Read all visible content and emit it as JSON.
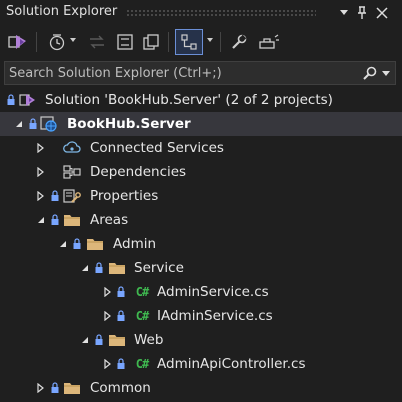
{
  "window": {
    "title": "Solution Explorer"
  },
  "search": {
    "placeholder": "Search Solution Explorer (Ctrl+;)"
  },
  "tree": {
    "solution": "Solution 'BookHub.Server' (2 of 2 projects)",
    "project": "BookHub.Server",
    "connected_services": "Connected Services",
    "dependencies": "Dependencies",
    "properties": "Properties",
    "areas": "Areas",
    "admin": "Admin",
    "service": "Service",
    "admin_service_cs": "AdminService.cs",
    "iadmin_service_cs": "IAdminService.cs",
    "web": "Web",
    "admin_api_controller_cs": "AdminApiController.cs",
    "common": "Common"
  },
  "colors": {
    "background": "#1f1f1f",
    "selected_row": "#37373d",
    "folder": "#dcb67a",
    "csharp": "#3fb950",
    "project_icon": "#4aa3ff"
  }
}
